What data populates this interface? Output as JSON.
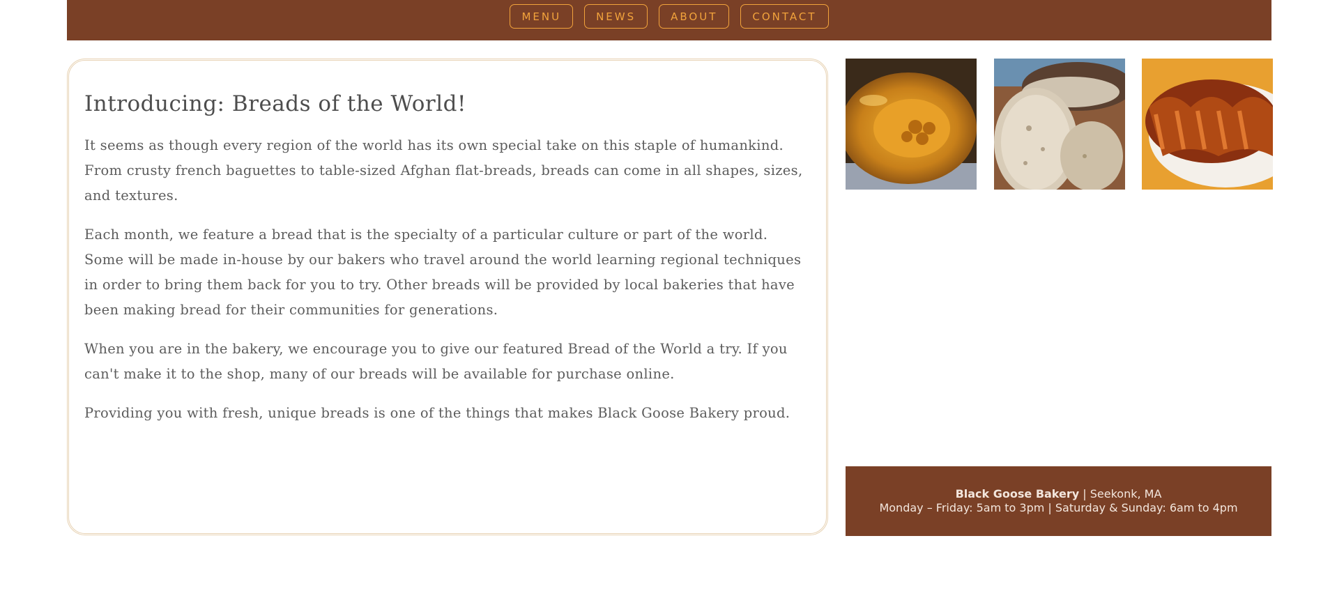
{
  "nav": {
    "items": [
      {
        "label": "MENU"
      },
      {
        "label": "NEWS"
      },
      {
        "label": "ABOUT"
      },
      {
        "label": "CONTACT"
      }
    ]
  },
  "article": {
    "title": "Introducing: Breads of the World!",
    "paragraphs": [
      "It seems as though every region of the world has its own special take on this staple of humankind. From crusty french baguettes to table-sized Afghan flat-breads, breads can come in all shapes, sizes, and textures.",
      "Each month, we feature a bread that is the specialty of a particular culture or part of the world. Some will be made in-house by our bakers who travel around the world learning regional techniques in order to bring them back for you to try. Other breads will be provided by local bakeries that have been making bread for their communities for generations.",
      "When you are in the bakery, we encourage you to give our featured Bread of the World a try. If you can't make it to the shop, many of our breads will be available for purchase online.",
      "Providing you with fresh, unique breads is one of the things that makes Black Goose Bakery proud."
    ]
  },
  "info": {
    "name": "Black Goose Bakery",
    "location": " | Seekonk, MA",
    "hours": "Monday – Friday: 5am to 3pm | Saturday & Sunday: 6am to 4pm"
  },
  "colors": {
    "brand_brown": "#7a4026",
    "nav_accent": "#f2a33c",
    "card_border": "#e7d2b3"
  }
}
